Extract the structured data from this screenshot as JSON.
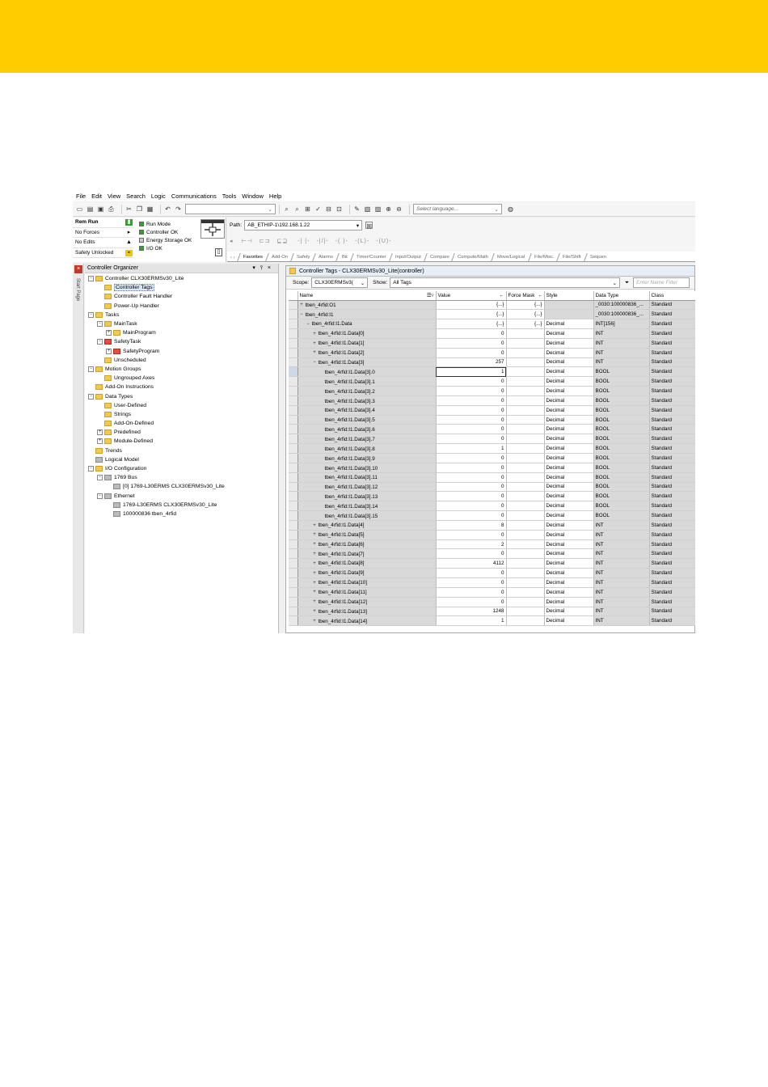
{
  "menu": [
    "File",
    "Edit",
    "View",
    "Search",
    "Logic",
    "Communications",
    "Tools",
    "Window",
    "Help"
  ],
  "toolbar": {
    "language_placeholder": "Select language..."
  },
  "status": {
    "mode": "Rem Run",
    "forces": "No Forces",
    "edits": "No Edits",
    "safety": "Safety Unlocked",
    "leds": [
      "Run Mode",
      "Controller OK",
      "Energy Storage OK",
      "I/O OK"
    ],
    "colors": {
      "led_on": "#22aa22",
      "led_off": "#cccccc"
    }
  },
  "path": {
    "label": "Path:",
    "value": "AB_ETHIP-1\\192.168.1.22"
  },
  "instruction_tabs": [
    "Favorites",
    "Add-On",
    "Safety",
    "Alarms",
    "Bit",
    "Timer/Counter",
    "Input/Output",
    "Compare",
    "Compute/Math",
    "Move/Logical",
    "File/Misc.",
    "File/Shift",
    "Sequen"
  ],
  "side_strip": {
    "label": "Start Page"
  },
  "organizer": {
    "title": "Controller Organizer",
    "tree": [
      {
        "label": "Controller CLX30ERMSv30_Lite",
        "level": 0,
        "exp": "-",
        "icon": "folder"
      },
      {
        "label": "Controller Tags",
        "level": 1,
        "exp": "",
        "icon": "folder",
        "selected": true
      },
      {
        "label": "Controller Fault Handler",
        "level": 1,
        "exp": "",
        "icon": "folder"
      },
      {
        "label": "Power-Up Handler",
        "level": 1,
        "exp": "",
        "icon": "folder"
      },
      {
        "label": "Tasks",
        "level": 0,
        "exp": "-",
        "icon": "folder"
      },
      {
        "label": "MainTask",
        "level": 1,
        "exp": "-",
        "icon": "folder"
      },
      {
        "label": "MainProgram",
        "level": 2,
        "exp": "+",
        "icon": "folder"
      },
      {
        "label": "SafetyTask",
        "level": 1,
        "exp": "-",
        "icon": "red"
      },
      {
        "label": "SafetyProgram",
        "level": 2,
        "exp": "+",
        "icon": "red"
      },
      {
        "label": "Unscheduled",
        "level": 1,
        "exp": "",
        "icon": "folder"
      },
      {
        "label": "Motion Groups",
        "level": 0,
        "exp": "-",
        "icon": "folder"
      },
      {
        "label": "Ungrouped Axes",
        "level": 1,
        "exp": "",
        "icon": "folder"
      },
      {
        "label": "Add-On Instructions",
        "level": 0,
        "exp": "",
        "icon": "folder"
      },
      {
        "label": "Data Types",
        "level": 0,
        "exp": "-",
        "icon": "folder"
      },
      {
        "label": "User-Defined",
        "level": 1,
        "exp": "",
        "icon": "folder"
      },
      {
        "label": "Strings",
        "level": 1,
        "exp": "",
        "icon": "folder"
      },
      {
        "label": "Add-On-Defined",
        "level": 1,
        "exp": "",
        "icon": "folder"
      },
      {
        "label": "Predefined",
        "level": 1,
        "exp": "+",
        "icon": "folder"
      },
      {
        "label": "Module-Defined",
        "level": 1,
        "exp": "+",
        "icon": "folder"
      },
      {
        "label": "Trends",
        "level": 0,
        "exp": "",
        "icon": "folder"
      },
      {
        "label": "Logical Model",
        "level": 0,
        "exp": "",
        "icon": "gray"
      },
      {
        "label": "I/O Configuration",
        "level": 0,
        "exp": "-",
        "icon": "folder"
      },
      {
        "label": "1769 Bus",
        "level": 1,
        "exp": "-",
        "icon": "gray"
      },
      {
        "label": "[0] 1769-L30ERMS CLX30ERMSv30_Lite",
        "level": 2,
        "exp": "",
        "icon": "gray"
      },
      {
        "label": "Ethernet",
        "level": 1,
        "exp": "-",
        "icon": "gray"
      },
      {
        "label": "1769-L30ERMS CLX30ERMSv30_Lite",
        "level": 2,
        "exp": "",
        "icon": "gray"
      },
      {
        "label": "100000836 tben_4rfid",
        "level": 2,
        "exp": "",
        "icon": "gray"
      }
    ]
  },
  "tags": {
    "title": "Controller Tags - CLX30ERMSv30_Lite(controller)",
    "scope_label": "Scope:",
    "scope_value": "CLX30ERMSv3(",
    "show_label": "Show:",
    "show_value": "All Tags",
    "filter_placeholder": "Enter Name Filter",
    "columns": [
      "Name",
      "Value",
      "Force Mask",
      "Style",
      "Data Type",
      "Class"
    ],
    "rows": [
      {
        "indent": 0,
        "pm": "+",
        "name": "tben_4rfid:O1",
        "value": "{...}",
        "force": "{...}",
        "style": "",
        "type": "_0030:100000836_...",
        "cls": "Standard"
      },
      {
        "indent": 0,
        "pm": "-",
        "name": "tben_4rfid:I1",
        "value": "{...}",
        "force": "{...}",
        "style": "",
        "type": "_0030:100000836_...",
        "cls": "Standard"
      },
      {
        "indent": 1,
        "pm": "-",
        "name": "tben_4rfid:I1.Data",
        "value": "{...}",
        "force": "{...}",
        "style": "Decimal",
        "type": "INT[156]",
        "cls": "Standard"
      },
      {
        "indent": 2,
        "pm": "+",
        "name": "tben_4rfid:I1.Data[0]",
        "value": "0",
        "force": "",
        "style": "Decimal",
        "type": "INT",
        "cls": "Standard"
      },
      {
        "indent": 2,
        "pm": "+",
        "name": "tben_4rfid:I1.Data[1]",
        "value": "0",
        "force": "",
        "style": "Decimal",
        "type": "INT",
        "cls": "Standard"
      },
      {
        "indent": 2,
        "pm": "+",
        "name": "tben_4rfid:I1.Data[2]",
        "value": "0",
        "force": "",
        "style": "Decimal",
        "type": "INT",
        "cls": "Standard"
      },
      {
        "indent": 2,
        "pm": "-",
        "name": "tben_4rfid:I1.Data[3]",
        "value": "257",
        "force": "",
        "style": "Decimal",
        "type": "INT",
        "cls": "Standard"
      },
      {
        "indent": 3,
        "pm": "",
        "name": "tben_4rfid:I1.Data[3].0",
        "value": "1",
        "force": "",
        "style": "Decimal",
        "type": "BOOL",
        "cls": "Standard",
        "active": true
      },
      {
        "indent": 3,
        "pm": "",
        "name": "tben_4rfid:I1.Data[3].1",
        "value": "0",
        "force": "",
        "style": "Decimal",
        "type": "BOOL",
        "cls": "Standard"
      },
      {
        "indent": 3,
        "pm": "",
        "name": "tben_4rfid:I1.Data[3].2",
        "value": "0",
        "force": "",
        "style": "Decimal",
        "type": "BOOL",
        "cls": "Standard"
      },
      {
        "indent": 3,
        "pm": "",
        "name": "tben_4rfid:I1.Data[3].3",
        "value": "0",
        "force": "",
        "style": "Decimal",
        "type": "BOOL",
        "cls": "Standard"
      },
      {
        "indent": 3,
        "pm": "",
        "name": "tben_4rfid:I1.Data[3].4",
        "value": "0",
        "force": "",
        "style": "Decimal",
        "type": "BOOL",
        "cls": "Standard"
      },
      {
        "indent": 3,
        "pm": "",
        "name": "tben_4rfid:I1.Data[3].5",
        "value": "0",
        "force": "",
        "style": "Decimal",
        "type": "BOOL",
        "cls": "Standard"
      },
      {
        "indent": 3,
        "pm": "",
        "name": "tben_4rfid:I1.Data[3].6",
        "value": "0",
        "force": "",
        "style": "Decimal",
        "type": "BOOL",
        "cls": "Standard"
      },
      {
        "indent": 3,
        "pm": "",
        "name": "tben_4rfid:I1.Data[3].7",
        "value": "0",
        "force": "",
        "style": "Decimal",
        "type": "BOOL",
        "cls": "Standard"
      },
      {
        "indent": 3,
        "pm": "",
        "name": "tben_4rfid:I1.Data[3].8",
        "value": "1",
        "force": "",
        "style": "Decimal",
        "type": "BOOL",
        "cls": "Standard"
      },
      {
        "indent": 3,
        "pm": "",
        "name": "tben_4rfid:I1.Data[3].9",
        "value": "0",
        "force": "",
        "style": "Decimal",
        "type": "BOOL",
        "cls": "Standard"
      },
      {
        "indent": 3,
        "pm": "",
        "name": "tben_4rfid:I1.Data[3].10",
        "value": "0",
        "force": "",
        "style": "Decimal",
        "type": "BOOL",
        "cls": "Standard"
      },
      {
        "indent": 3,
        "pm": "",
        "name": "tben_4rfid:I1.Data[3].11",
        "value": "0",
        "force": "",
        "style": "Decimal",
        "type": "BOOL",
        "cls": "Standard"
      },
      {
        "indent": 3,
        "pm": "",
        "name": "tben_4rfid:I1.Data[3].12",
        "value": "0",
        "force": "",
        "style": "Decimal",
        "type": "BOOL",
        "cls": "Standard"
      },
      {
        "indent": 3,
        "pm": "",
        "name": "tben_4rfid:I1.Data[3].13",
        "value": "0",
        "force": "",
        "style": "Decimal",
        "type": "BOOL",
        "cls": "Standard"
      },
      {
        "indent": 3,
        "pm": "",
        "name": "tben_4rfid:I1.Data[3].14",
        "value": "0",
        "force": "",
        "style": "Decimal",
        "type": "BOOL",
        "cls": "Standard"
      },
      {
        "indent": 3,
        "pm": "",
        "name": "tben_4rfid:I1.Data[3].15",
        "value": "0",
        "force": "",
        "style": "Decimal",
        "type": "BOOL",
        "cls": "Standard"
      },
      {
        "indent": 2,
        "pm": "+",
        "name": "tben_4rfid:I1.Data[4]",
        "value": "8",
        "force": "",
        "style": "Decimal",
        "type": "INT",
        "cls": "Standard"
      },
      {
        "indent": 2,
        "pm": "+",
        "name": "tben_4rfid:I1.Data[5]",
        "value": "0",
        "force": "",
        "style": "Decimal",
        "type": "INT",
        "cls": "Standard"
      },
      {
        "indent": 2,
        "pm": "+",
        "name": "tben_4rfid:I1.Data[6]",
        "value": "2",
        "force": "",
        "style": "Decimal",
        "type": "INT",
        "cls": "Standard"
      },
      {
        "indent": 2,
        "pm": "+",
        "name": "tben_4rfid:I1.Data[7]",
        "value": "0",
        "force": "",
        "style": "Decimal",
        "type": "INT",
        "cls": "Standard"
      },
      {
        "indent": 2,
        "pm": "+",
        "name": "tben_4rfid:I1.Data[8]",
        "value": "4112",
        "force": "",
        "style": "Decimal",
        "type": "INT",
        "cls": "Standard"
      },
      {
        "indent": 2,
        "pm": "+",
        "name": "tben_4rfid:I1.Data[9]",
        "value": "0",
        "force": "",
        "style": "Decimal",
        "type": "INT",
        "cls": "Standard"
      },
      {
        "indent": 2,
        "pm": "+",
        "name": "tben_4rfid:I1.Data[10]",
        "value": "0",
        "force": "",
        "style": "Decimal",
        "type": "INT",
        "cls": "Standard"
      },
      {
        "indent": 2,
        "pm": "+",
        "name": "tben_4rfid:I1.Data[11]",
        "value": "0",
        "force": "",
        "style": "Decimal",
        "type": "INT",
        "cls": "Standard"
      },
      {
        "indent": 2,
        "pm": "+",
        "name": "tben_4rfid:I1.Data[12]",
        "value": "0",
        "force": "",
        "style": "Decimal",
        "type": "INT",
        "cls": "Standard"
      },
      {
        "indent": 2,
        "pm": "+",
        "name": "tben_4rfid:I1.Data[13]",
        "value": "1248",
        "force": "",
        "style": "Decimal",
        "type": "INT",
        "cls": "Standard"
      },
      {
        "indent": 2,
        "pm": "+",
        "name": "tben_4rfid:I1.Data[14]",
        "value": "1",
        "force": "",
        "style": "Decimal",
        "type": "INT",
        "cls": "Standard"
      }
    ]
  },
  "colors": {
    "banner": "#ffcc00"
  }
}
